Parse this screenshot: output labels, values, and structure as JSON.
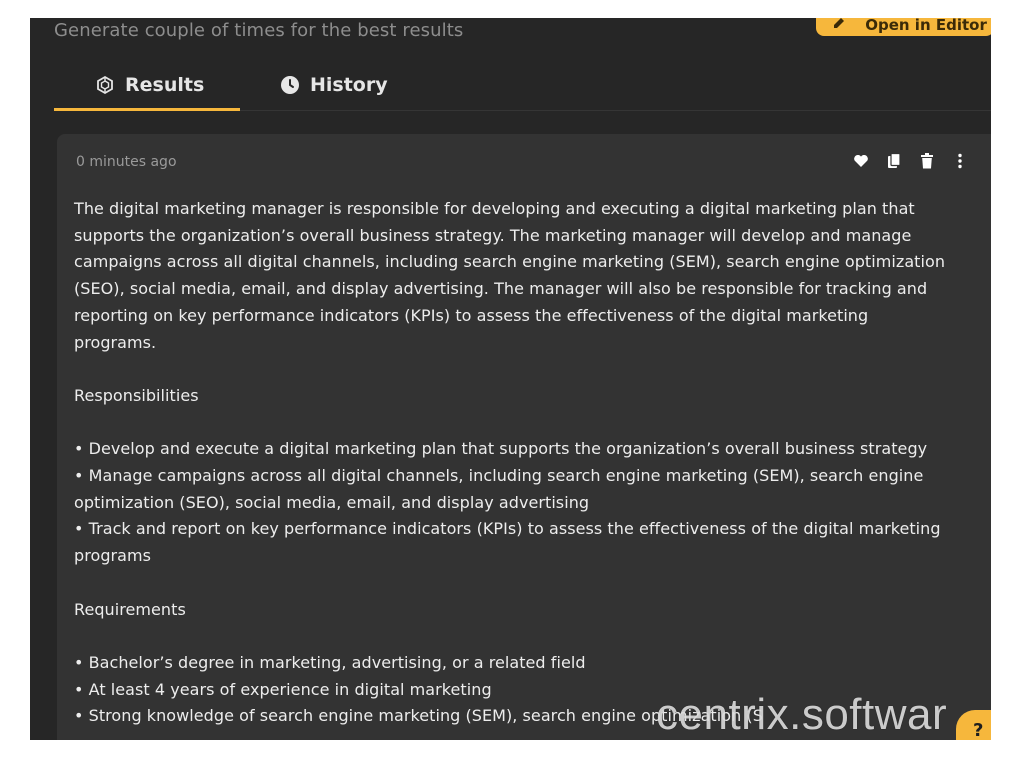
{
  "header": {
    "subtitle": "Generate couple of times for the best results",
    "open_editor_label": "Open in Editor"
  },
  "tabs": [
    {
      "label": "Results",
      "icon": "ai-cube-icon",
      "active": true
    },
    {
      "label": "History",
      "icon": "clock-icon",
      "active": false
    }
  ],
  "result_card": {
    "timestamp": "0 minutes ago",
    "actions": [
      "heart-icon",
      "copy-icon",
      "trash-icon",
      "more-vertical-icon"
    ],
    "lines": [
      "The digital marketing manager is responsible for developing and executing a digital marketing plan that supports the organization’s overall business strategy. The marketing manager will develop and manage campaigns across all digital channels, including search engine marketing (SEM), search engine optimization (SEO), social media, email, and display advertising. The manager will also be responsible for tracking and reporting on key performance indicators (KPIs) to assess the effectiveness of the digital marketing programs.",
      "Responsibilities",
      "• Develop and execute a digital marketing plan that supports the organization’s overall business strategy",
      "• Manage campaigns across all digital channels, including search engine marketing (SEM), search engine optimization (SEO), social media, email, and display advertising",
      "• Track and report on key performance indicators (KPIs) to assess the effectiveness of the digital marketing programs",
      "Requirements",
      "• Bachelor’s degree in marketing, advertising, or a related field",
      "• At least 4 years of experience in digital marketing",
      "• Strong knowledge of search engine marketing (SEM), search engine optimization (S"
    ]
  },
  "help_label": "?",
  "watermark": "centrix.softwar",
  "colors": {
    "background": "#262626",
    "card": "#333333",
    "accent": "#f6b73c",
    "text": "#ededed",
    "muted": "#9a9a9a"
  }
}
